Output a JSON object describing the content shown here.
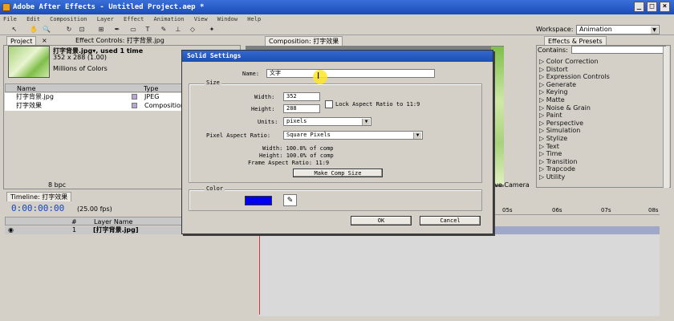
{
  "app": {
    "title": "Adobe After Effects - Untitled Project.aep *"
  },
  "menu": [
    "File",
    "Edit",
    "Composition",
    "Layer",
    "Effect",
    "Animation",
    "View",
    "Window",
    "Help"
  ],
  "workspace": {
    "label": "Workspace:",
    "value": "Animation"
  },
  "project_panel": {
    "tab_project": "Project",
    "tab_effect_controls": "Effect Controls: 打字背景.jpg",
    "item_name": "打字背景.jpg▾, used 1 time",
    "item_dims": "352 x 288 (1.00)",
    "item_colors": "Millions of Colors",
    "col_name": "Name",
    "col_type": "Type",
    "rows": [
      {
        "name": "打字背景.jpg",
        "type": "JPEG"
      },
      {
        "name": "打字效果",
        "type": "Composition"
      }
    ],
    "bpc": "8 bpc"
  },
  "composition": {
    "tab": "Composition: 打字效果",
    "active_camera": "ive Camera"
  },
  "effects_panel": {
    "tab": "Effects & Presets",
    "contains_label": "Contains:",
    "items": [
      "Color Correction",
      "Distort",
      "Expression Controls",
      "Generate",
      "Keying",
      "Matte",
      "Noise & Grain",
      "Paint",
      "Perspective",
      "Simulation",
      "Stylize",
      "Text",
      "Time",
      "Transition",
      "Trapcode",
      "Utility"
    ]
  },
  "timeline": {
    "tab": "Timeline: 打字效果",
    "timecode": "0:00:00:00",
    "fps": "(25.00 fps)",
    "col_layer_name": "Layer Name",
    "layer_index": "1",
    "layer_name": "[打字背景.jpg]",
    "ruler": [
      "05s",
      "06s",
      "07s",
      "08s"
    ]
  },
  "dialog": {
    "title": "Solid Settings",
    "name_label": "Name:",
    "name_value": "文字",
    "size_group": "Size",
    "width_label": "Width:",
    "width_value": "352",
    "height_label": "Height:",
    "height_value": "288",
    "lock_label": "Lock Aspect Ratio to 11:9",
    "units_label": "Units:",
    "units_value": "pixels",
    "par_label": "Pixel Aspect Ratio:",
    "par_value": "Square Pixels",
    "info_width": "Width:  100.0% of comp",
    "info_height": "Height:  100.0% of comp",
    "info_frame": "Frame Aspect Ratio: 11:9",
    "make_comp_size": "Make Comp Size",
    "color_group": "Color",
    "color_value": "#0000ee",
    "ok": "OK",
    "cancel": "Cancel"
  }
}
